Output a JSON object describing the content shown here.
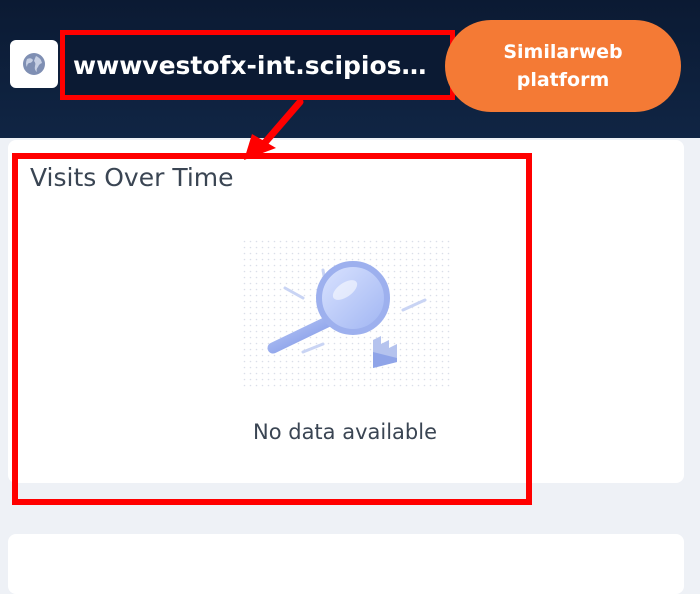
{
  "header": {
    "site_icon": "globe-icon",
    "domain": "wwwvestofx-int.scipioso…",
    "platform_button": "Similarweb platform"
  },
  "visits_card": {
    "title": "Visits Over Time",
    "empty_message": "No data available",
    "empty_icon": "magnifying-glass-icon"
  },
  "colors": {
    "header_bg": "#0b1a33",
    "accent": "#f47a35",
    "annotation": "#ff0000"
  }
}
